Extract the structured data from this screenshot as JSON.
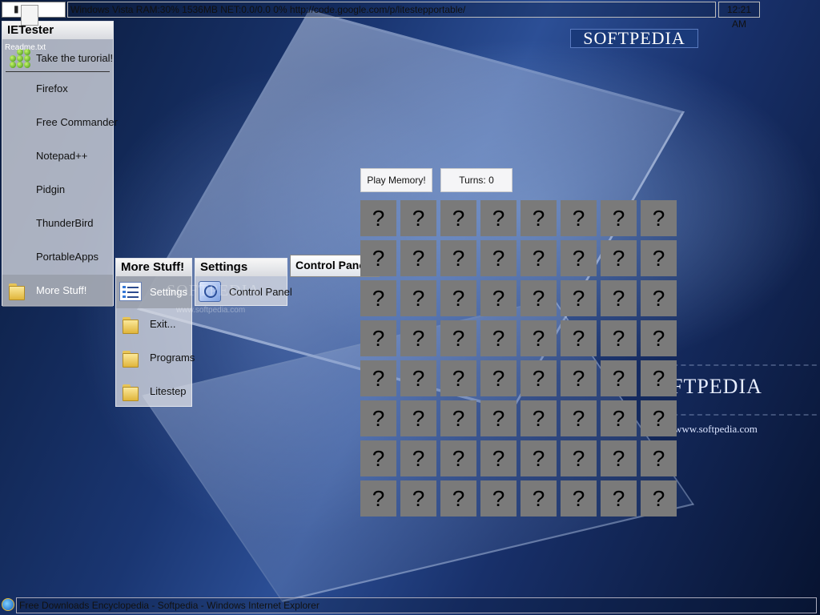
{
  "topbar": {
    "status_text": "Windows Vista RAM:30% 1536MB NET:0.0/0.0  0% http://code.google.com/p/litestepportable/",
    "clock": "12:21 AM"
  },
  "desktop": {
    "icon_label": "Readme.txt"
  },
  "main_menu": {
    "title": "IETester",
    "items": [
      {
        "label": "Take the turorial!"
      },
      {
        "label": "Firefox"
      },
      {
        "label": "Free Commander"
      },
      {
        "label": "Notepad++"
      },
      {
        "label": "Pidgin"
      },
      {
        "label": "ThunderBird"
      },
      {
        "label": "PortableApps"
      },
      {
        "label": "More Stuff!"
      }
    ]
  },
  "more_menu": {
    "title": "More Stuff!",
    "items": [
      {
        "label": "Settings"
      },
      {
        "label": "Exit..."
      },
      {
        "label": "Programs"
      },
      {
        "label": "Litestep"
      }
    ]
  },
  "settings_menu": {
    "title": "Settings",
    "items": [
      {
        "label": "Control Panel"
      }
    ]
  },
  "tooltip": {
    "title": "Control Panel"
  },
  "game": {
    "play_label": "Play Memory!",
    "turns_label": "Turns: 0",
    "rows": 8,
    "cols": 8,
    "cell_text": "?"
  },
  "brand": {
    "logo_text": "SOFTPEDIA",
    "big_text": "FTPEDIA",
    "url": "www.softpedia.com",
    "watermark": "SOFTPEDIA",
    "watermark_url": "www.softpedia.com"
  },
  "bottombar": {
    "window_title": "Free Downloads Encyclopedia - Softpedia - Windows Internet Explorer"
  },
  "colors": {
    "card": "#7a7a7a",
    "menu_bg": "#d7dae1",
    "menu_selected": "#969ba5"
  }
}
